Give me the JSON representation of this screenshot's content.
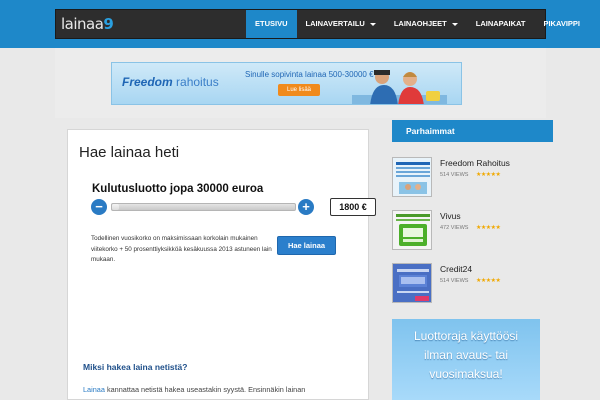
{
  "header": {
    "logo_text": "lainaa",
    "logo_number": "9",
    "nav": [
      {
        "label": "ETUSIVU",
        "active": true,
        "dropdown": false
      },
      {
        "label": "LAINAVERTAILU",
        "active": false,
        "dropdown": true
      },
      {
        "label": "LAINAOHJEET",
        "active": false,
        "dropdown": true
      },
      {
        "label": "LAINAPAIKAT",
        "active": false,
        "dropdown": false
      },
      {
        "label": "PIKAVIPPI",
        "active": false,
        "dropdown": false
      }
    ]
  },
  "banner": {
    "brand_main": "Freedom",
    "brand_sub": " rahoitus",
    "tagline": "Sinulle sopivinta lainaa 500-30000 €",
    "button": "Lue lisää"
  },
  "main": {
    "title": "Hae lainaa heti",
    "calculator": {
      "title": "Kulutusluotto jopa 30000 euroa",
      "minus": "−",
      "plus": "+",
      "amount": "1800 €",
      "slider_fraction": 0.04,
      "disclaimer": "Todellinen vuosikorko on maksimissaan korkolain mukainen viitekorko + 50 prosenttiyksikköä kesäkuussa 2013 astuneen lain mukaan.",
      "apply_button": "Hae lainaa"
    },
    "why_title": "Miksi hakea laina netistä?",
    "why_link": "Lainaa",
    "why_text": " kannattaa netistä hakea useastakin syystä. Ensinnäkin lainan"
  },
  "sidebar": {
    "heading": "Parhaimmat",
    "items": [
      {
        "name": "Freedom Rahoitus",
        "views": "514 VIEWS",
        "stars": "★★★★★"
      },
      {
        "name": "Vivus",
        "views": "472 VIEWS",
        "stars": "★★★★★"
      },
      {
        "name": "Credit24",
        "views": "514 VIEWS",
        "stars": "★★★★★"
      }
    ],
    "ad": {
      "line1": "Luottoraja käyttöösi",
      "line2": "ilman avaus- tai",
      "line3": "vuosimaksua!"
    }
  },
  "colors": {
    "accent": "#1e88c9",
    "navbar": "#2d2d2d",
    "button": "#2b7fcc",
    "banner_button": "#f08a1c",
    "stars": "#f0a800"
  }
}
